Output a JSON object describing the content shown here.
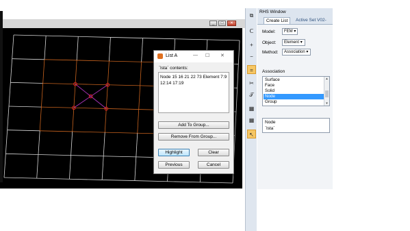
{
  "main_window": {
    "controls": {
      "minimize": "_",
      "maximize": "□",
      "close": "✕"
    }
  },
  "dialog": {
    "title": "List A",
    "controls": {
      "minimize": "—",
      "maximize": "☐",
      "close": "✕"
    },
    "contents_label": "`lsta` contents:",
    "contents_text": "Node 15 16 21 22 73 Element 7:9 12:14 17:19",
    "buttons": {
      "add_to_group": "Add To Group...",
      "remove_from_group": "Remove From Group...",
      "highlight": "Highlight",
      "clear": "Clear",
      "previous": "Previous",
      "cancel": "Cancel"
    }
  },
  "toolbar": {
    "icons": [
      "copy-icon",
      "lasso-icon",
      "plus-icon",
      "minus-icon",
      "equals-icon",
      "tools-icon",
      "pin-icon",
      "grid-icon",
      "grid2-icon",
      "select-arrow-icon"
    ],
    "glyphs": [
      "⧉",
      "ᑕ",
      "+",
      "−",
      "=",
      "✂",
      "𝒯",
      "▦",
      "▦",
      "↖"
    ]
  },
  "rhs": {
    "title": "RHS Window",
    "tabs": {
      "create_list": "Create List",
      "active_set": "Active Set V02-97"
    },
    "model_label": "Model:",
    "model_value": "FEM",
    "object_label": "Object:",
    "object_value": "Element",
    "method_label": "Method:",
    "method_value": "Association",
    "association_label": "Association",
    "association_items": [
      "Surface",
      "Face",
      "Solid",
      "Node",
      "Group"
    ],
    "association_selected": "Node",
    "node_label": "Node",
    "node_value": "`lsta`"
  },
  "colors": {
    "viewport_bg": "#000000",
    "mesh_white": "#d8d8d8",
    "mesh_orange": "#c8631e",
    "node_red": "#e02020",
    "diag_magenta": "#9a2fa8",
    "selection_blue": "#3399ff",
    "tool_selected": "#f6c765"
  }
}
